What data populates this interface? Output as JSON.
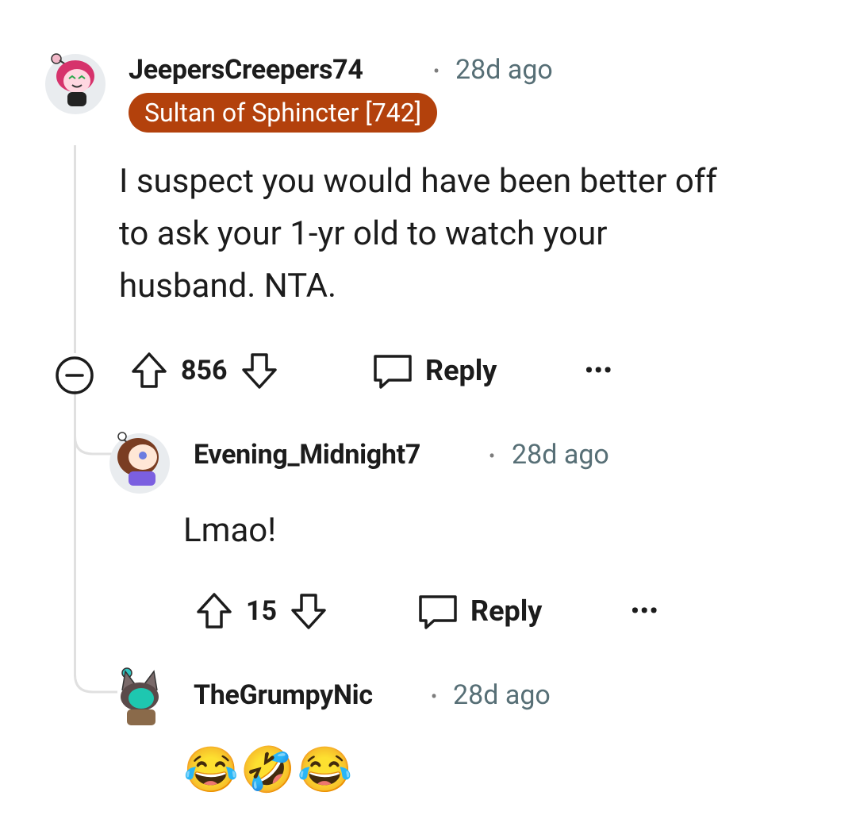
{
  "comments": [
    {
      "username": "JeepersCreepers74",
      "separator": "•",
      "time": "28d ago",
      "flair": "Sultan of Sphincter [742]",
      "body_lines": [
        "I suspect you would have been better off",
        "to ask your 1-yr old to watch your",
        "husband. NTA."
      ],
      "votes": "856",
      "reply_label": "Reply",
      "more_label": "•••"
    },
    {
      "username": "Evening_Midnight7",
      "separator": "•",
      "time": "28d ago",
      "body_lines": [
        "Lmao!"
      ],
      "votes": "15",
      "reply_label": "Reply",
      "more_label": "•••"
    },
    {
      "username": "TheGrumpyNic",
      "separator": "•",
      "time": "28d ago",
      "body_emojis": [
        "😂",
        "🤣",
        "😂"
      ]
    }
  ],
  "colors": {
    "flair_bg": "#b3410c",
    "thread_line": "#e0e0e0",
    "meta_gray": "#576f76"
  },
  "icons": [
    "collapse-icon",
    "upvote-icon",
    "downvote-icon",
    "reply-bubble-icon",
    "more-options-icon"
  ]
}
